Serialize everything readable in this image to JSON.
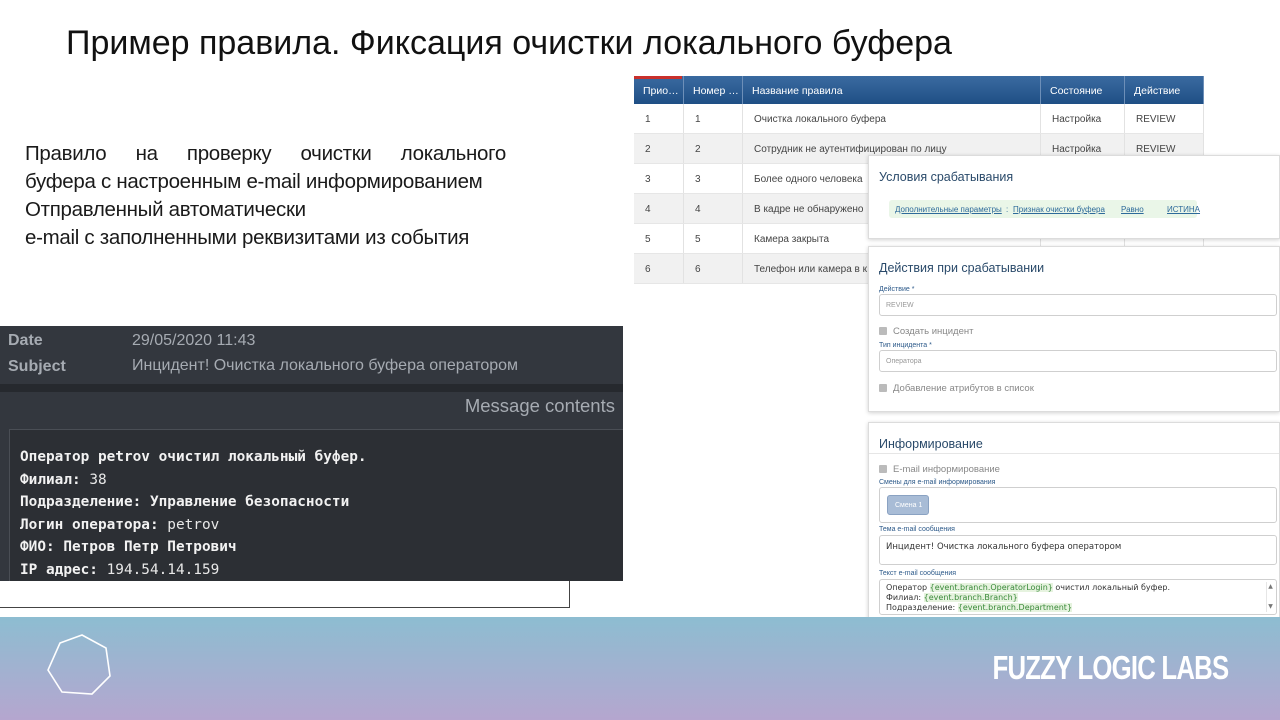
{
  "title": "Пример правила. Фиксация очистки локального буфера",
  "description": {
    "line1": "Правило на проверку очистки локального",
    "line2": "буфера с настроенным e-mail информированием",
    "line3": "Отправленный  автоматически",
    "line4": "e-mail с заполненными реквизитами из события"
  },
  "rules_table": {
    "headers": [
      "Прио…",
      "Номер …",
      "Название правила",
      "Состояние",
      "Действие"
    ],
    "rows": [
      [
        "1",
        "1",
        "Очистка локального буфера",
        "Настройка",
        "REVIEW"
      ],
      [
        "2",
        "2",
        "Сотрудник не аутентифицирован по лицу",
        "Настройка",
        "REVIEW"
      ],
      [
        "3",
        "3",
        "Более одного человека",
        "",
        ""
      ],
      [
        "4",
        "4",
        "В кадре не обнаружено",
        "",
        ""
      ],
      [
        "5",
        "5",
        "Камера закрыта",
        "",
        ""
      ],
      [
        "6",
        "6",
        "Телефон или камера в к",
        "",
        ""
      ]
    ]
  },
  "conditions_panel": {
    "title": "Условия срабатывания",
    "param": "Дополнительные параметры",
    "sep": ":",
    "attr": "Признак очистки буфера",
    "op": "Равно",
    "value": "ИСТИНА"
  },
  "actions_panel": {
    "title": "Действия при срабатывании",
    "action_label": "Действие *",
    "action_value": "REVIEW",
    "create_incident": "Создать инцидент",
    "incident_type_label": "Тип инцидента *",
    "incident_type_value": "Оператора",
    "add_attributes": "Добавление атрибутов в список"
  },
  "inform_panel": {
    "title": "Информирование",
    "email_check": "E-mail информирование",
    "shifts_label": "Смены для e-mail информирования",
    "shift_tag": "Смена 1",
    "subject_label": "Тема e-mail сообщения",
    "subject_value": "Инцидент! Очистка локального буфера оператором",
    "text_label": "Текст e-mail сообщения",
    "text_line1_a": "Оператор ",
    "text_line1_var": "{event.branch.OperatorLogin}",
    "text_line1_b": " очистил локальный буфер.",
    "text_line2_a": "Филиал: ",
    "text_line2_var": "{event.branch.Branch}",
    "text_line3_a": "Подразделение: ",
    "text_line3_var": "{event.branch.Department}"
  },
  "email": {
    "date_label": "Date",
    "date_value": "29/05/2020 11:43",
    "subject_label": "Subject",
    "subject_value": "Инцидент! Очистка локального буфера оператором",
    "contents_label": "Message contents",
    "lines": [
      {
        "k": "Оператор petrov очистил локальный буфер.",
        "v": ""
      },
      {
        "k": "Филиал:",
        "v": " 38"
      },
      {
        "k": "Подразделение: Управление безопасности",
        "v": ""
      },
      {
        "k": "Логин оператора:",
        "v": " petrov"
      },
      {
        "k": "ФИО: Петров Петр Петрович",
        "v": ""
      },
      {
        "k": "IP адрес:",
        "v": " 194.54.14.159"
      }
    ]
  },
  "footer": {
    "brand": "FUZZY LOGIC LABS"
  }
}
